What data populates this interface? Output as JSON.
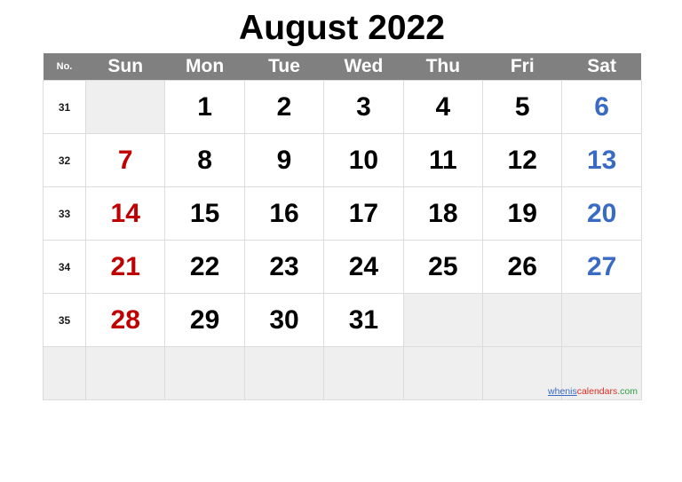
{
  "title": "August 2022",
  "colors": {
    "header_bar": "#808080",
    "sunday": "#C00000",
    "saturday": "#3A6BC4",
    "weekday": "#000000",
    "empty_cell": "#EFEFEF",
    "grid_line": "#DCDCDC"
  },
  "header": {
    "week_column_label": "No.",
    "days": [
      "Sun",
      "Mon",
      "Tue",
      "Wed",
      "Thu",
      "Fri",
      "Sat"
    ]
  },
  "weeks": [
    {
      "number": "31",
      "days": [
        {
          "label": "",
          "empty": true,
          "kind": "sun"
        },
        {
          "label": "1",
          "empty": false,
          "kind": "weekday"
        },
        {
          "label": "2",
          "empty": false,
          "kind": "weekday"
        },
        {
          "label": "3",
          "empty": false,
          "kind": "weekday"
        },
        {
          "label": "4",
          "empty": false,
          "kind": "weekday"
        },
        {
          "label": "5",
          "empty": false,
          "kind": "weekday"
        },
        {
          "label": "6",
          "empty": false,
          "kind": "sat"
        }
      ]
    },
    {
      "number": "32",
      "days": [
        {
          "label": "7",
          "empty": false,
          "kind": "sun"
        },
        {
          "label": "8",
          "empty": false,
          "kind": "weekday"
        },
        {
          "label": "9",
          "empty": false,
          "kind": "weekday"
        },
        {
          "label": "10",
          "empty": false,
          "kind": "weekday"
        },
        {
          "label": "11",
          "empty": false,
          "kind": "weekday"
        },
        {
          "label": "12",
          "empty": false,
          "kind": "weekday"
        },
        {
          "label": "13",
          "empty": false,
          "kind": "sat"
        }
      ]
    },
    {
      "number": "33",
      "days": [
        {
          "label": "14",
          "empty": false,
          "kind": "sun"
        },
        {
          "label": "15",
          "empty": false,
          "kind": "weekday"
        },
        {
          "label": "16",
          "empty": false,
          "kind": "weekday"
        },
        {
          "label": "17",
          "empty": false,
          "kind": "weekday"
        },
        {
          "label": "18",
          "empty": false,
          "kind": "weekday"
        },
        {
          "label": "19",
          "empty": false,
          "kind": "weekday"
        },
        {
          "label": "20",
          "empty": false,
          "kind": "sat"
        }
      ]
    },
    {
      "number": "34",
      "days": [
        {
          "label": "21",
          "empty": false,
          "kind": "sun"
        },
        {
          "label": "22",
          "empty": false,
          "kind": "weekday"
        },
        {
          "label": "23",
          "empty": false,
          "kind": "weekday"
        },
        {
          "label": "24",
          "empty": false,
          "kind": "weekday"
        },
        {
          "label": "25",
          "empty": false,
          "kind": "weekday"
        },
        {
          "label": "26",
          "empty": false,
          "kind": "weekday"
        },
        {
          "label": "27",
          "empty": false,
          "kind": "sat"
        }
      ]
    },
    {
      "number": "35",
      "days": [
        {
          "label": "28",
          "empty": false,
          "kind": "sun"
        },
        {
          "label": "29",
          "empty": false,
          "kind": "weekday"
        },
        {
          "label": "30",
          "empty": false,
          "kind": "weekday"
        },
        {
          "label": "31",
          "empty": false,
          "kind": "weekday"
        },
        {
          "label": "",
          "empty": true,
          "kind": "weekday"
        },
        {
          "label": "",
          "empty": true,
          "kind": "weekday"
        },
        {
          "label": "",
          "empty": true,
          "kind": "sat"
        }
      ]
    },
    {
      "number": "",
      "blank": true,
      "days": [
        {
          "label": "",
          "empty": true,
          "kind": "sun"
        },
        {
          "label": "",
          "empty": true,
          "kind": "weekday"
        },
        {
          "label": "",
          "empty": true,
          "kind": "weekday"
        },
        {
          "label": "",
          "empty": true,
          "kind": "weekday"
        },
        {
          "label": "",
          "empty": true,
          "kind": "weekday"
        },
        {
          "label": "",
          "empty": true,
          "kind": "weekday"
        },
        {
          "label": "",
          "empty": true,
          "kind": "sat"
        }
      ]
    }
  ],
  "watermark": {
    "part1": "whenis",
    "part2": "calendars",
    "part3": ".com"
  }
}
